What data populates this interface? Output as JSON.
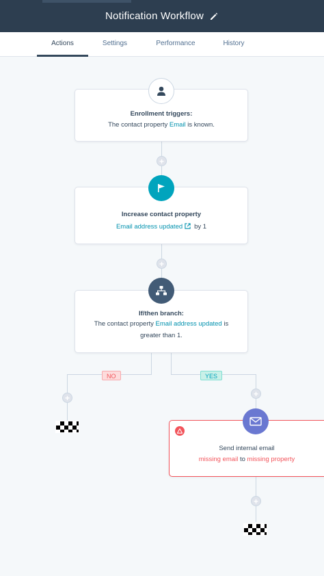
{
  "header": {
    "title": "Notification Workflow",
    "edit_icon": "pencil-icon"
  },
  "tabs": [
    {
      "label": "Actions",
      "active": true
    },
    {
      "label": "Settings",
      "active": false
    },
    {
      "label": "Performance",
      "active": false
    },
    {
      "label": "History",
      "active": false
    }
  ],
  "workflow": {
    "trigger": {
      "icon": "user-icon",
      "title": "Enrollment triggers:",
      "text_before": "The contact property",
      "property": "Email",
      "text_after": "is known."
    },
    "action_increase": {
      "icon": "flag-icon",
      "title": "Increase contact property",
      "property": "Email address updated",
      "text_after": "by 1"
    },
    "branch": {
      "icon": "branch-icon",
      "title": "If/then branch:",
      "text_before": "The contact property",
      "property": "Email address updated",
      "text_after": "is",
      "text_line2": "greater than 1."
    },
    "no_label": "NO",
    "yes_label": "YES",
    "send_email": {
      "icon": "envelope-icon",
      "warning_icon": "warning-icon",
      "title": "Send internal email",
      "missing_email": "missing email",
      "to": "to",
      "missing_property": "missing property"
    }
  },
  "colors": {
    "header_bg": "#2d3e50",
    "trigger_icon_bg": "#ffffff",
    "action_icon_bg": "#00a4bd",
    "branch_icon_bg": "#425b76",
    "email_icon_bg": "#6a78d1",
    "error": "#f2545b",
    "link": "#0091ae"
  }
}
